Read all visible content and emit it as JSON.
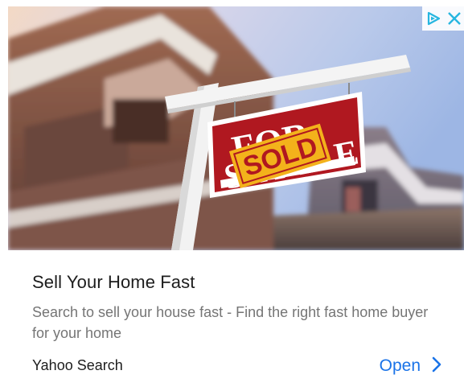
{
  "ad": {
    "headline": "Sell Your Home Fast",
    "description": "Search to sell your house fast - Find the right fast home buyer for your home",
    "advertiser": "Yahoo Search",
    "cta_label": "Open",
    "accent_color": "#1a73e8",
    "adchoices_color": "#27b6e0"
  },
  "hero": {
    "sign_top": "FOR",
    "sign_bottom": "SALE",
    "rider": "SOLD"
  },
  "icons": {
    "adchoices": "adchoices-triangle-icon",
    "close": "close-x-icon",
    "chevron": "chevron-right-icon"
  }
}
